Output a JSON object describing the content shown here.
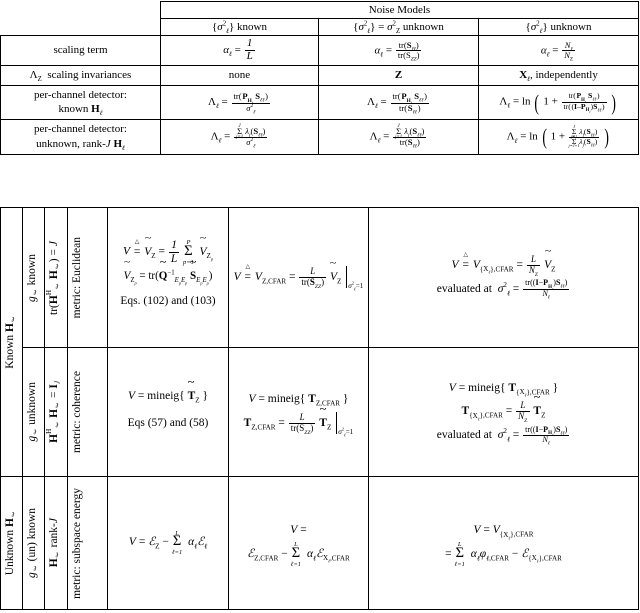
{
  "document": {
    "kind": "two-part technical table of detectors and CFAR statistics"
  },
  "top_table": {
    "header_group": "Noise Models",
    "columns": [
      {
        "id": "sigma_known",
        "label_parts": [
          "{",
          "σ",
          "2",
          "ℓ",
          "} known"
        ]
      },
      {
        "id": "sigma_common_unknown",
        "label_parts": [
          "{",
          "σ",
          "2",
          "ℓ",
          "} = ",
          "σ",
          "2",
          "Z",
          " unknown"
        ]
      },
      {
        "id": "sigma_unknown",
        "label_parts": [
          "{",
          "σ",
          "2",
          "ℓ",
          "} unknown"
        ]
      }
    ],
    "column_labels_plain": [
      "{σ²ℓ} known",
      "{σ²ℓ} = σ²Z unknown",
      "{σ²ℓ} unknown"
    ],
    "rows": [
      {
        "label": "scaling term",
        "label_lines": [
          "scaling term"
        ],
        "cells": [
          "α_ℓ = 1 / L",
          "α_ℓ = tr(S_ℓℓ) / tr(S_ZZ)",
          "α_ℓ = N_ℓ / N_Z"
        ]
      },
      {
        "label": "Λ_Z scaling invariances",
        "label_lines": [
          "Λ_Z  scaling invariances"
        ],
        "cells": [
          "none",
          "Z",
          "X_ℓ, independently"
        ]
      },
      {
        "label": "per-channel detector: known H_ℓ",
        "label_lines": [
          "per-channel detector:",
          "known H_ℓ"
        ],
        "cells": [
          "Λ_ℓ = tr(P_{H_ℓ} S_ℓℓ) / σ²_ℓ",
          "Λ_ℓ = tr(P_{H_ℓ} S_ℓℓ) / tr(S_ℓℓ)",
          "Λ_ℓ = ln( 1 + tr(P_{H_ℓ} S_ℓℓ) / tr((I−P_{H_ℓ}) S_ℓℓ) )"
        ]
      },
      {
        "label": "per-channel detector: unknown, rank-J H_ℓ",
        "label_lines": [
          "per-channel detector:",
          "unknown, rank-J H_ℓ"
        ],
        "cells": [
          "Λ_ℓ = Σ_{j=1}^{J} λ_j(S_ℓℓ) / σ²_ℓ",
          "Λ_ℓ = Σ_{j=1}^{J} λ_j(S_ℓℓ) / tr(S_ℓℓ)",
          "Λ_ℓ = ln( 1 + Σ_{j=1}^{J} λ_j(S_ℓℓ) / Σ_{j=J+1}^{N_ℓ} λ_j(S_ℓℓ) )"
        ]
      }
    ]
  },
  "bottom_table": {
    "group_labels": [
      {
        "id": "known-H",
        "text": "Known H_ℓ"
      },
      {
        "id": "unknown-H",
        "text": "Unknown H_ℓ"
      }
    ],
    "rows": [
      {
        "group": "Known H_ℓ",
        "g_label": "g_ℓ known",
        "constraint": "tr(H^H_ℓ H_ℓ) = J",
        "metric": "metric: Euclidean",
        "cells": [
          {
            "lines": [
              "V ≜ Ṽ_Z = (1/L) Σ_{p=1}^{P} Ṽ_{Z_p}",
              "Ṽ_{Z_p} = tr( Q̃^{-1}_{E_p E_p} S̃_{E_p E_p} )",
              "Eqs. (102) and (103)"
            ]
          },
          {
            "lines": [
              "V ≜ V_{Z,CFAR} = ( L / tr(S_ZZ) ) Ṽ_Z |_{σ²_ℓ = 1}"
            ]
          },
          {
            "lines": [
              "V ≜ V_{X_ℓ},CFAR = ( L / N_Z ) Ṽ_Z",
              "evaluated at  σ²_ℓ = tr((I−P_{H_ℓ}) S_ℓℓ) / N_ℓ"
            ]
          }
        ]
      },
      {
        "group": "Known H_ℓ",
        "g_label": "g_ℓ unknown",
        "constraint": "H^H_ℓ H_ℓ = I_J",
        "metric": "metric: coherence",
        "cells": [
          {
            "lines": [
              "V = mineig{ T̃_Z }",
              "Eqs (57) and (58)"
            ]
          },
          {
            "lines": [
              "V = mineig{ T_{Z,CFAR} }",
              "T_{Z,CFAR} = ( L / tr(S_ZZ) ) T̃_Z |_{σ²_ℓ = 1}"
            ]
          },
          {
            "lines": [
              "V = mineig{ T_{X_ℓ},CFAR }",
              "T_{X_ℓ},CFAR = ( L / N_Z ) T̃_Z",
              "evaluated at  σ²_ℓ = tr((I−P_{H_ℓ}) S_ℓℓ) / N_ℓ"
            ]
          }
        ]
      },
      {
        "group": "Unknown H_ℓ",
        "g_label": "g_ℓ (un) known",
        "constraint": "H_ℓ rank-J",
        "metric": "metric: subspace energy",
        "cells": [
          {
            "lines": [
              "V = E_Z − Σ_{ℓ=1}^{L} α_ℓ E_ℓ"
            ]
          },
          {
            "lines": [
              "V =",
              "E_{Z,CFAR} − Σ_{ℓ=1}^{L} α_ℓ E_{X_ℓ,CFAR}"
            ]
          },
          {
            "lines": [
              "V = V_{X_ℓ},CFAR",
              "= Σ_{ℓ=1}^{L} α_ℓ φ_{ℓ,CFAR} − E_{X_ℓ},CFAR"
            ]
          }
        ]
      }
    ]
  },
  "colors": {
    "text": "#000000",
    "rule": "#000000",
    "background": "#ffffff"
  }
}
